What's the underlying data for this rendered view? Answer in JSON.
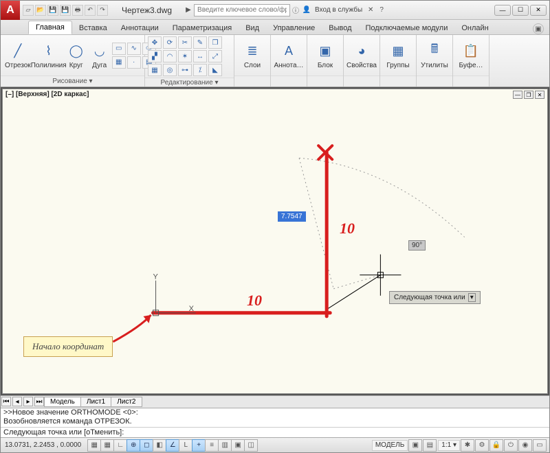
{
  "title": "Чертеж3.dwg",
  "search_placeholder": "Введите ключевое слово/фразу",
  "signin": "Вход в службы",
  "tabs": [
    "Главная",
    "Вставка",
    "Аннотации",
    "Параметризация",
    "Вид",
    "Управление",
    "Вывод",
    "Подключаемые модули",
    "Онлайн"
  ],
  "active_tab": 0,
  "draw_panel": {
    "title": "Рисование ▾",
    "items": [
      "Отрезок",
      "Полилиния",
      "Круг",
      "Дуга"
    ]
  },
  "edit_panel": {
    "title": "Редактирование ▾"
  },
  "other_panels": [
    "Слои",
    "Аннота…",
    "Блок",
    "Свойства",
    "Группы",
    "Утилиты",
    "Буфе…"
  ],
  "viewport_label": "[–] [Верхняя] [2D каркас]",
  "ann_origin": "Начало координат",
  "dyn_value": "7.7547",
  "angle_value": "90°",
  "tooltip_next": "Следующая точка или",
  "hand_h": "10",
  "hand_v": "10",
  "ucs": {
    "x": "X",
    "y": "Y"
  },
  "btm": {
    "tabs": [
      "Модель",
      "Лист1",
      "Лист2"
    ],
    "active": 0
  },
  "cmd": {
    "hist": ">>Новое значение ORTHOMODE <0>:\nВозобновляется команда ОТРЕЗОК.",
    "prompt": "Следующая точка или [оТменить]:"
  },
  "status": {
    "coords": "13.0731, 2.2453 , 0.0000",
    "model": "МОДЕЛЬ",
    "scale": "1:1 ▾"
  }
}
